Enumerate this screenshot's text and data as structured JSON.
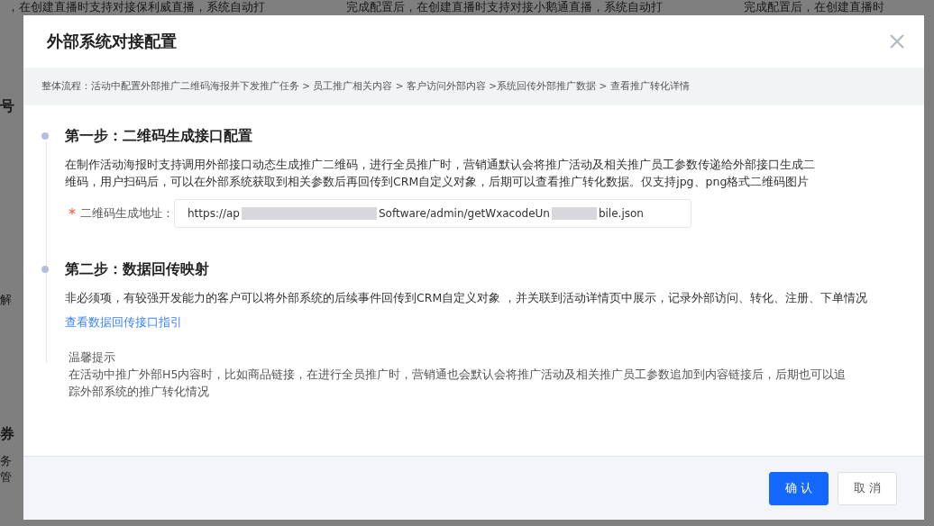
{
  "background": {
    "texts": [
      {
        "text": "，在创建直播时支持对接保利威直播，系统自动打"
      },
      {
        "text": "完成配置后，在创建直播时支持对接小鹅通直播，系统自动打"
      },
      {
        "text": "完成配置后，在创建直播时"
      }
    ],
    "edge_texts": [
      {
        "text": "号",
        "kind": "heading"
      },
      {
        "text": "解",
        "kind": "line"
      },
      {
        "text": "券",
        "kind": "heading"
      },
      {
        "text": "务",
        "kind": "line"
      },
      {
        "text": "管",
        "kind": "line"
      }
    ]
  },
  "dialog": {
    "title": "外部系统对接配置",
    "flow": "整体流程：活动中配置外部推广二维码海报并下发推广任务 > 员工推广相关内容 > 客户访问外部内容 >系统回传外部推广数据 > 查看推广转化详情",
    "steps": [
      {
        "title": "第一步：二维码生成接口配置",
        "description": "在制作活动海报时支持调用外部接口动态生成推广二维码，进行全员推广时，营销通默认会将推广活动及相关推广员工参数传递给外部接口生成二维码，用户扫码后，可以在外部系统获取到相关参数后再回传到CRM自定义对象，后期可以查看推广转化数据。仅支持jpg、png格式二维码图片",
        "field": {
          "label": "二维码生成地址：",
          "required_mark": "*",
          "value_parts": [
            "https://ap",
            "Software/admin/getWxacodeUn",
            "bile.json"
          ]
        }
      },
      {
        "title": "第二步：数据回传映射",
        "description": "非必须项，有较强开发能力的客户可以将外部系统的后续事件回传到CRM自定义对象 ，并关联到活动详情页中展示，记录外部访问、转化、注册、下单情况",
        "link": "查看数据回传接口指引"
      }
    ],
    "tip": {
      "title": "温馨提示",
      "text": "在活动中推广外部H5内容时，比如商品链接，在进行全员推广时，营销通也会默认会将推广活动及相关推广员工参数追加到内容链接后，后期也可以追踪外部系统的推广转化情况"
    },
    "buttons": [
      {
        "label": "确 认",
        "kind": "primary"
      },
      {
        "label": "取 消",
        "kind": "default"
      }
    ]
  }
}
